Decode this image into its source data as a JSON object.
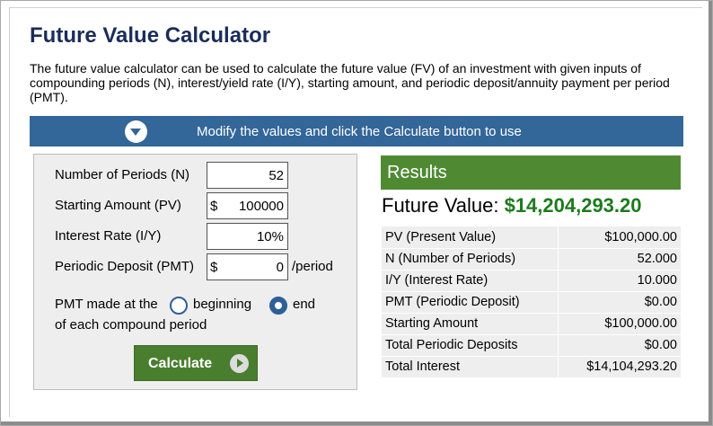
{
  "title": "Future Value Calculator",
  "description": "The future value calculator can be used to calculate the future value (FV) of an investment with given inputs of compounding periods (N), interest/yield rate (I/Y), starting amount, and periodic deposit/annuity payment per period (PMT).",
  "banner": {
    "icon": "chevron-down-circle-icon",
    "text": "Modify the values and click the Calculate button to use"
  },
  "inputs": {
    "periods": {
      "label": "Number of Periods (N)",
      "value": "52"
    },
    "starting": {
      "label": "Starting Amount (PV)",
      "prefix": "$",
      "value": "100000"
    },
    "rate": {
      "label": "Interest Rate (I/Y)",
      "value": "10",
      "suffix": "%"
    },
    "deposit": {
      "label": "Periodic Deposit (PMT)",
      "prefix": "$",
      "value": "0",
      "suffix": "/period"
    },
    "pmt_timing": {
      "lead": "PMT made at the",
      "option_beginning": "beginning",
      "option_end": "end",
      "selected": "end",
      "tail": "of each compound period"
    },
    "calculate_label": "Calculate"
  },
  "results": {
    "heading": "Results",
    "fv_label": "Future Value:",
    "fv_value": "$14,204,293.20",
    "rows": [
      {
        "key": "PV (Present Value)",
        "value": "$100,000.00"
      },
      {
        "key": "N (Number of Periods)",
        "value": "52.000"
      },
      {
        "key": "I/Y (Interest Rate)",
        "value": "10.000"
      },
      {
        "key": "PMT (Periodic Deposit)",
        "value": "$0.00"
      },
      {
        "key": "Starting Amount",
        "value": "$100,000.00"
      },
      {
        "key": "Total Periodic Deposits",
        "value": "$0.00"
      },
      {
        "key": "Total Interest",
        "value": "$14,104,293.20"
      }
    ]
  },
  "colors": {
    "title": "#1a2d5a",
    "banner": "#336699",
    "results_header": "#4f8a33",
    "fv_value": "#1d7a1d",
    "calculate_button": "#4a7e2f"
  }
}
